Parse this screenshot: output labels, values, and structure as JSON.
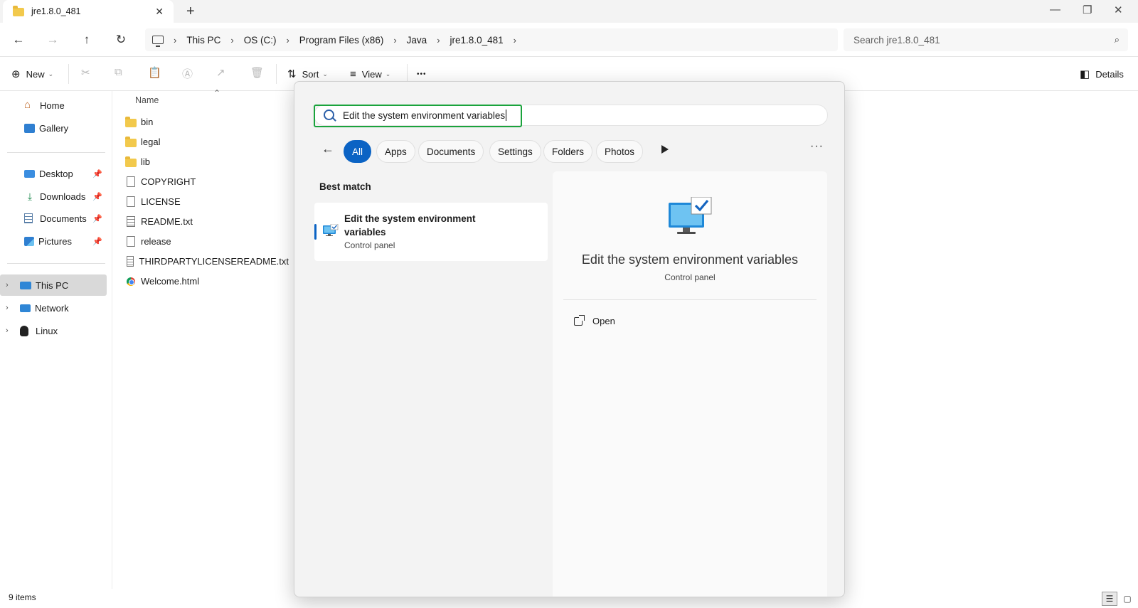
{
  "window": {
    "tab_title": "jre1.8.0_481",
    "close_glyph": "✕",
    "new_tab_glyph": "+",
    "minimize_glyph": "—",
    "restore_glyph": "❐",
    "close_window_glyph": "✕"
  },
  "address": {
    "back_glyph": "←",
    "forward_glyph": "→",
    "up_glyph": "↑",
    "refresh_glyph": "↻",
    "sep_glyph": "›",
    "crumbs": [
      "This PC",
      "OS (C:)",
      "Program Files (x86)",
      "Java",
      "jre1.8.0_481"
    ],
    "search_placeholder": "Search jre1.8.0_481",
    "search_glyph": "⌕"
  },
  "toolbar": {
    "new_icon": "⊕",
    "new_label": "New",
    "sort_icon": "⇅",
    "sort_label": "Sort",
    "view_icon": "≡",
    "view_label": "View",
    "caret": "⌄",
    "more_glyph": "•••",
    "details_icon": "◧",
    "details_label": "Details",
    "dim_icons": [
      "✂",
      "⧉",
      "📋",
      "Ⓐ",
      "↗",
      "🗑"
    ]
  },
  "nav": {
    "items": [
      {
        "label": "Home",
        "icon": "home-icon"
      },
      {
        "label": "Gallery",
        "icon": "gallery-icon"
      },
      {
        "label": "Desktop",
        "icon": "desktop-icon",
        "pinned": true
      },
      {
        "label": "Downloads",
        "icon": "download-icon",
        "pinned": true
      },
      {
        "label": "Documents",
        "icon": "documents-icon",
        "pinned": true
      },
      {
        "label": "Pictures",
        "icon": "pictures-icon",
        "pinned": true
      },
      {
        "label": "This PC",
        "icon": "computer-icon",
        "selected": true
      },
      {
        "label": "Network",
        "icon": "network-icon"
      },
      {
        "label": "Linux",
        "icon": "linux-icon"
      }
    ],
    "pin_glyph": "📌",
    "expand_glyph": "›"
  },
  "files": {
    "column_name": "Name",
    "sort_caret": "⌃",
    "items": [
      {
        "name": "bin",
        "type": "folder"
      },
      {
        "name": "legal",
        "type": "folder"
      },
      {
        "name": "lib",
        "type": "folder"
      },
      {
        "name": "COPYRIGHT",
        "type": "file"
      },
      {
        "name": "LICENSE",
        "type": "file"
      },
      {
        "name": "README.txt",
        "type": "text"
      },
      {
        "name": "release",
        "type": "file"
      },
      {
        "name": "THIRDPARTYLICENSEREADME.txt",
        "type": "text"
      },
      {
        "name": "Welcome.html",
        "type": "html"
      }
    ]
  },
  "status": {
    "count": "9 items",
    "details_view_glyph": "☰",
    "tiles_view_glyph": "▢"
  },
  "search_flyout": {
    "query": "Edit the system environment variables",
    "back_glyph": "←",
    "filters": [
      "All",
      "Apps",
      "Documents",
      "Settings",
      "Folders",
      "Photos"
    ],
    "active_filter": "All",
    "more_glyph": "···",
    "best_match_heading": "Best match",
    "result": {
      "title": "Edit the system environment variables",
      "subtitle": "Control panel"
    },
    "preview": {
      "title": "Edit the system environment variables",
      "subtitle": "Control panel",
      "open_label": "Open"
    },
    "colors": {
      "accent": "#0b63c4",
      "focus_ring": "#1aa33c"
    }
  }
}
